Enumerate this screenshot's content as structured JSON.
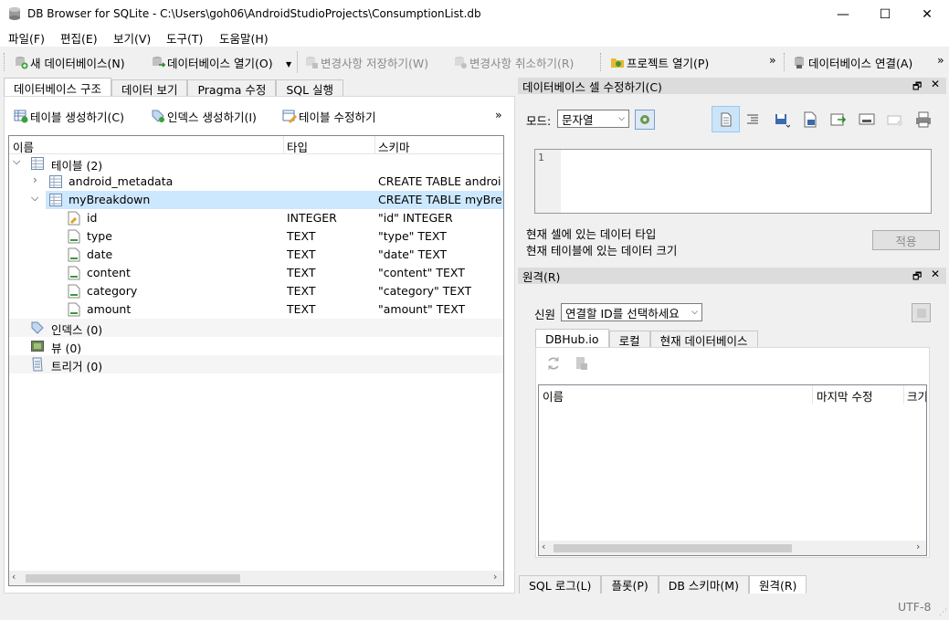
{
  "window": {
    "title": "DB Browser for SQLite - C:\\Users\\goh06\\AndroidStudioProjects\\ConsumptionList.db",
    "minimize_glyph": "—",
    "maximize_glyph": "☐",
    "close_glyph": "✕"
  },
  "menu": [
    "파일(F)",
    "편집(E)",
    "보기(V)",
    "도구(T)",
    "도움말(H)"
  ],
  "toolbar": {
    "new_db": "새 데이터베이스(N)",
    "open_db": "데이터베이스 열기(O)",
    "write_changes": "변경사항 저장하기(W)",
    "revert_changes": "변경사항 취소하기(R)",
    "open_project": "프로젝트 열기(P)",
    "more1": "»",
    "attach_db": "데이터베이스 연결(A)",
    "more2": "»"
  },
  "main_tabs": [
    "데이터베이스 구조",
    "데이터 보기",
    "Pragma 수정",
    "SQL 실행"
  ],
  "structure_toolbar": {
    "create_table": "테이블 생성하기(C)",
    "create_index": "인덱스 생성하기(I)",
    "modify_table": "테이블 수정하기",
    "more": "»"
  },
  "tree": {
    "columns": [
      "이름",
      "타입",
      "스키마"
    ],
    "tables_label": "테이블 (2)",
    "rows": [
      {
        "name": "android_metadata",
        "type": "",
        "schema": "CREATE TABLE androi"
      },
      {
        "name": "myBreakdown",
        "type": "",
        "schema": "CREATE TABLE myBre"
      }
    ],
    "fields": [
      {
        "name": "id",
        "type": "INTEGER",
        "schema": "\"id\" INTEGER"
      },
      {
        "name": "type",
        "type": "TEXT",
        "schema": "\"type\" TEXT"
      },
      {
        "name": "date",
        "type": "TEXT",
        "schema": "\"date\" TEXT"
      },
      {
        "name": "content",
        "type": "TEXT",
        "schema": "\"content\" TEXT"
      },
      {
        "name": "category",
        "type": "TEXT",
        "schema": "\"category\" TEXT"
      },
      {
        "name": "amount",
        "type": "TEXT",
        "schema": "\"amount\" TEXT"
      }
    ],
    "indices_label": "인덱스 (0)",
    "views_label": "뷰 (0)",
    "triggers_label": "트리거 (0)"
  },
  "edit_cell": {
    "title": "데이터베이스 셀 수정하기(C)",
    "mode_label": "모드:",
    "mode_value": "문자열",
    "line_number": "1",
    "data_type_label": "현재 셀에 있는 데이터 타입",
    "data_size_label": "현재 테이블에 있는 데이터 크기",
    "apply_button": "적용"
  },
  "remote": {
    "title": "원격(R)",
    "identity_label": "신원",
    "identity_placeholder": "연결할 ID를 선택하세요",
    "tabs": [
      "DBHub.io",
      "로컬",
      "현재 데이터베이스"
    ],
    "columns": [
      "이름",
      "마지막 수정",
      "크기"
    ]
  },
  "bottom_tabs": [
    "SQL 로그(L)",
    "플롯(P)",
    "DB 스키마(M)",
    "원격(R)"
  ],
  "status": {
    "encoding": "UTF-8"
  },
  "colors": {
    "selection": "#cce8ff",
    "accent": "#0078d7"
  }
}
